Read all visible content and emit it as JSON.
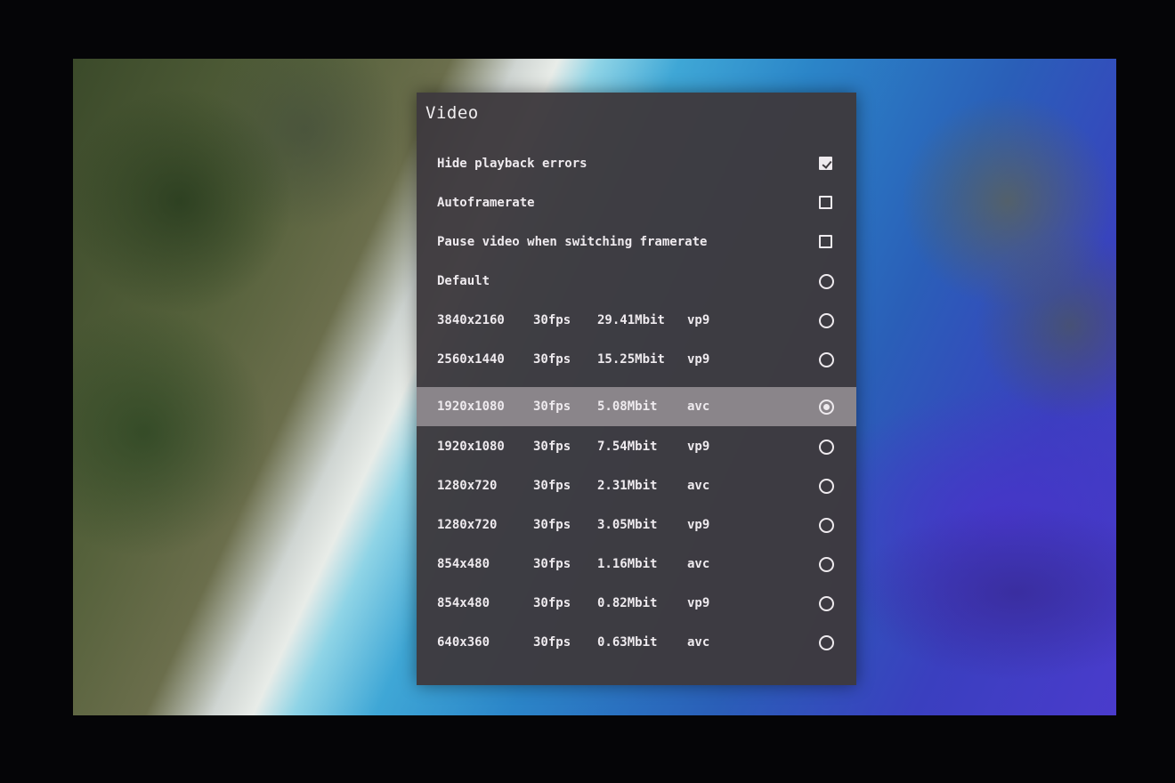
{
  "dialog": {
    "title": "Video",
    "toggles": [
      {
        "label": "Hide playback errors",
        "checked": true
      },
      {
        "label": "Autoframerate",
        "checked": false
      },
      {
        "label": "Pause video when switching framerate",
        "checked": false
      }
    ],
    "default_option": {
      "label": "Default",
      "selected": false
    },
    "formats": [
      {
        "resolution": "3840x2160",
        "fps": "30fps",
        "bitrate": "29.41Mbit",
        "codec": "vp9",
        "selected": false
      },
      {
        "resolution": "2560x1440",
        "fps": "30fps",
        "bitrate": "15.25Mbit",
        "codec": "vp9",
        "selected": false
      },
      {
        "resolution": "1920x1080",
        "fps": "30fps",
        "bitrate": "5.08Mbit",
        "codec": "avc",
        "selected": true
      },
      {
        "resolution": "1920x1080",
        "fps": "30fps",
        "bitrate": "7.54Mbit",
        "codec": "vp9",
        "selected": false
      },
      {
        "resolution": "1280x720",
        "fps": "30fps",
        "bitrate": "2.31Mbit",
        "codec": "avc",
        "selected": false
      },
      {
        "resolution": "1280x720",
        "fps": "30fps",
        "bitrate": "3.05Mbit",
        "codec": "vp9",
        "selected": false
      },
      {
        "resolution": "854x480",
        "fps": "30fps",
        "bitrate": "1.16Mbit",
        "codec": "avc",
        "selected": false
      },
      {
        "resolution": "854x480",
        "fps": "30fps",
        "bitrate": "0.82Mbit",
        "codec": "vp9",
        "selected": false
      },
      {
        "resolution": "640x360",
        "fps": "30fps",
        "bitrate": "0.63Mbit",
        "codec": "avc",
        "selected": false
      }
    ]
  },
  "colors": {
    "dialog_bg": "#3e3a3e",
    "selected_row_bg": "#8a858a",
    "text": "#eeeaee"
  }
}
